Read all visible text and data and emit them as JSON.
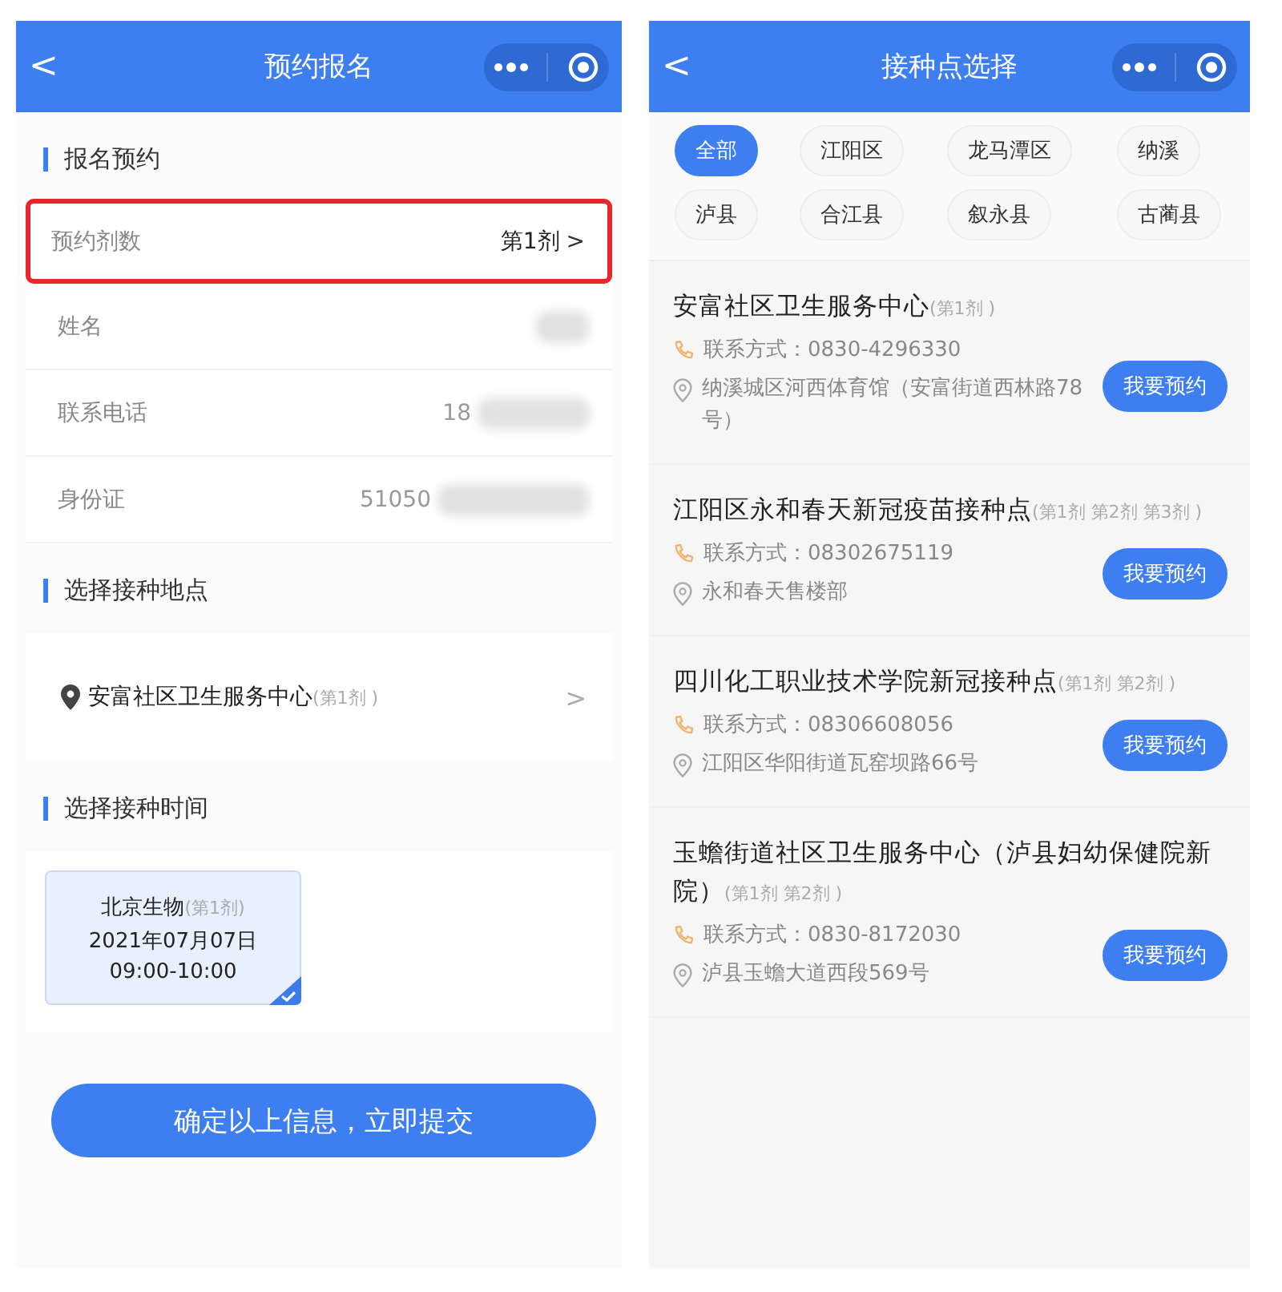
{
  "left_screen": {
    "title": "预约报名",
    "back": "<",
    "sections": [
      {
        "kind": "form",
        "title": "报名预约",
        "rows": [
          {
            "label": "预约剂数",
            "value": "第1剂",
            "highlighted": true,
            "redacted": false,
            "chevron": ">"
          },
          {
            "label": "姓名",
            "highlighted": false,
            "redacted": true
          },
          {
            "label": "联系电话",
            "value": "18",
            "highlighted": false,
            "redacted": true
          },
          {
            "label": "身份证",
            "value": "51050",
            "highlighted": false,
            "redacted": true
          }
        ]
      },
      {
        "kind": "location",
        "title": "选择接种地点",
        "place": "安富社区卫生服务中心",
        "note": "(第1剂 )",
        "chevron": ">"
      },
      {
        "kind": "time",
        "title": "选择接种时间",
        "slots": [
          {
            "vaccine": "北京生物",
            "note": "(第1剂)",
            "date": "2021年07月07日",
            "time": "09:00-10:00",
            "selected": true
          }
        ]
      }
    ],
    "submit": "确定以上信息，立即提交"
  },
  "right_screen": {
    "title": "接种点选择",
    "back": "<",
    "filters": [
      {
        "label": "全部",
        "selected": true
      },
      {
        "label": "江阳区",
        "selected": false
      },
      {
        "label": "龙马潭区",
        "selected": false
      },
      {
        "label": "纳溪",
        "selected": false
      },
      {
        "label": "泸县",
        "selected": false
      },
      {
        "label": "合江县",
        "selected": false
      },
      {
        "label": "叙永县",
        "selected": false
      },
      {
        "label": "古蔺县",
        "selected": false
      }
    ],
    "sites": [
      {
        "name": "安富社区卫生服务中心",
        "doses": "(第1剂 )",
        "phone": "联系方式：0830-4296330",
        "address": "纳溪城区河西体育馆（安富街道西林路78号）",
        "button": "我要预约"
      },
      {
        "name": "江阳区永和春天新冠疫苗接种点",
        "doses": "(第1剂 第2剂 第3剂 )",
        "phone": "联系方式：08302675119",
        "address": "永和春天售楼部",
        "button": "我要预约"
      },
      {
        "name": "四川化工职业技术学院新冠接种点",
        "doses": "(第1剂 第2剂 )",
        "phone": "联系方式：08306608056",
        "address": "江阳区华阳街道瓦窑坝路66号",
        "button": "我要预约"
      },
      {
        "name": "玉蟾街道社区卫生服务中心（泸县妇幼保健院新院）",
        "doses": "(第1剂 第2剂 )",
        "phone": "联系方式：0830-8172030",
        "address": "泸县玉蟾大道西段569号",
        "button": "我要预约"
      }
    ]
  }
}
